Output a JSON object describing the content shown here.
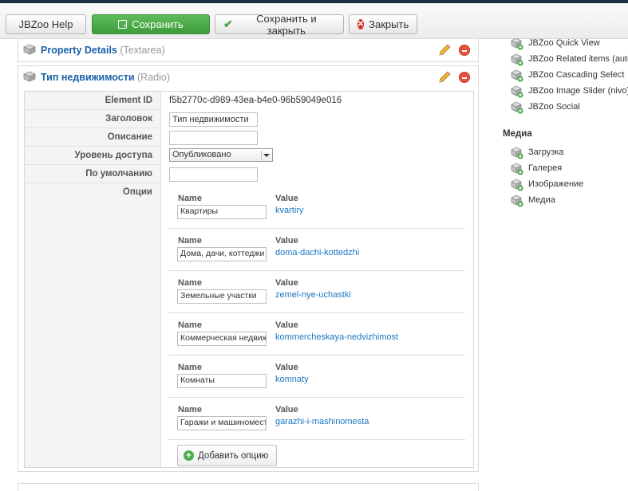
{
  "toolbar": {
    "help_label": "JBZoo Help",
    "save_label": "Сохранить",
    "save_close_label": "Сохранить и закрыть",
    "close_label": "Закрыть"
  },
  "elements": [
    {
      "title": "Property Details",
      "type": "(Textarea)"
    },
    {
      "title": "Тип недвижимости",
      "type": "(Radio)"
    }
  ],
  "params": {
    "element_id_label": "Element ID",
    "element_id_value": "f5b2770c-d989-43ea-b4e0-96b59049e016",
    "title_label": "Заголовок",
    "title_value": "Тип недвижимости",
    "description_label": "Описание",
    "description_value": "",
    "access_label": "Уровень доступа",
    "access_value": "Опубликовано",
    "default_label": "По умолчанию",
    "default_value": "",
    "options_label": "Опции",
    "name_col": "Name",
    "value_col": "Value",
    "options": [
      {
        "name": "Квартиры",
        "value": "kvartiry"
      },
      {
        "name": "Дома, дачи, коттеджи",
        "value": "doma-dachi-kottedzhi"
      },
      {
        "name": "Земельные участки",
        "value": "zemel-nye-uchastki"
      },
      {
        "name": "Коммерческая недвиж",
        "value": "kommercheskaya-nedvizhimost"
      },
      {
        "name": "Комнаты",
        "value": "komnaty"
      },
      {
        "name": "Гаражи и машиномест",
        "value": "garazhi-i-mashinomesta"
      }
    ],
    "add_option_label": "Добавить опцию"
  },
  "sidebar": {
    "group1_items": [
      "JBZoo Quick View",
      "JBZoo Related items (auto)",
      "JBZoo Cascading Select",
      "JBZoo Image Slider (nivo)",
      "JBZoo Social"
    ],
    "media_heading": "Медиа",
    "media_items": [
      "Загрузка",
      "Галерея",
      "Изображение",
      "Медиа"
    ]
  }
}
